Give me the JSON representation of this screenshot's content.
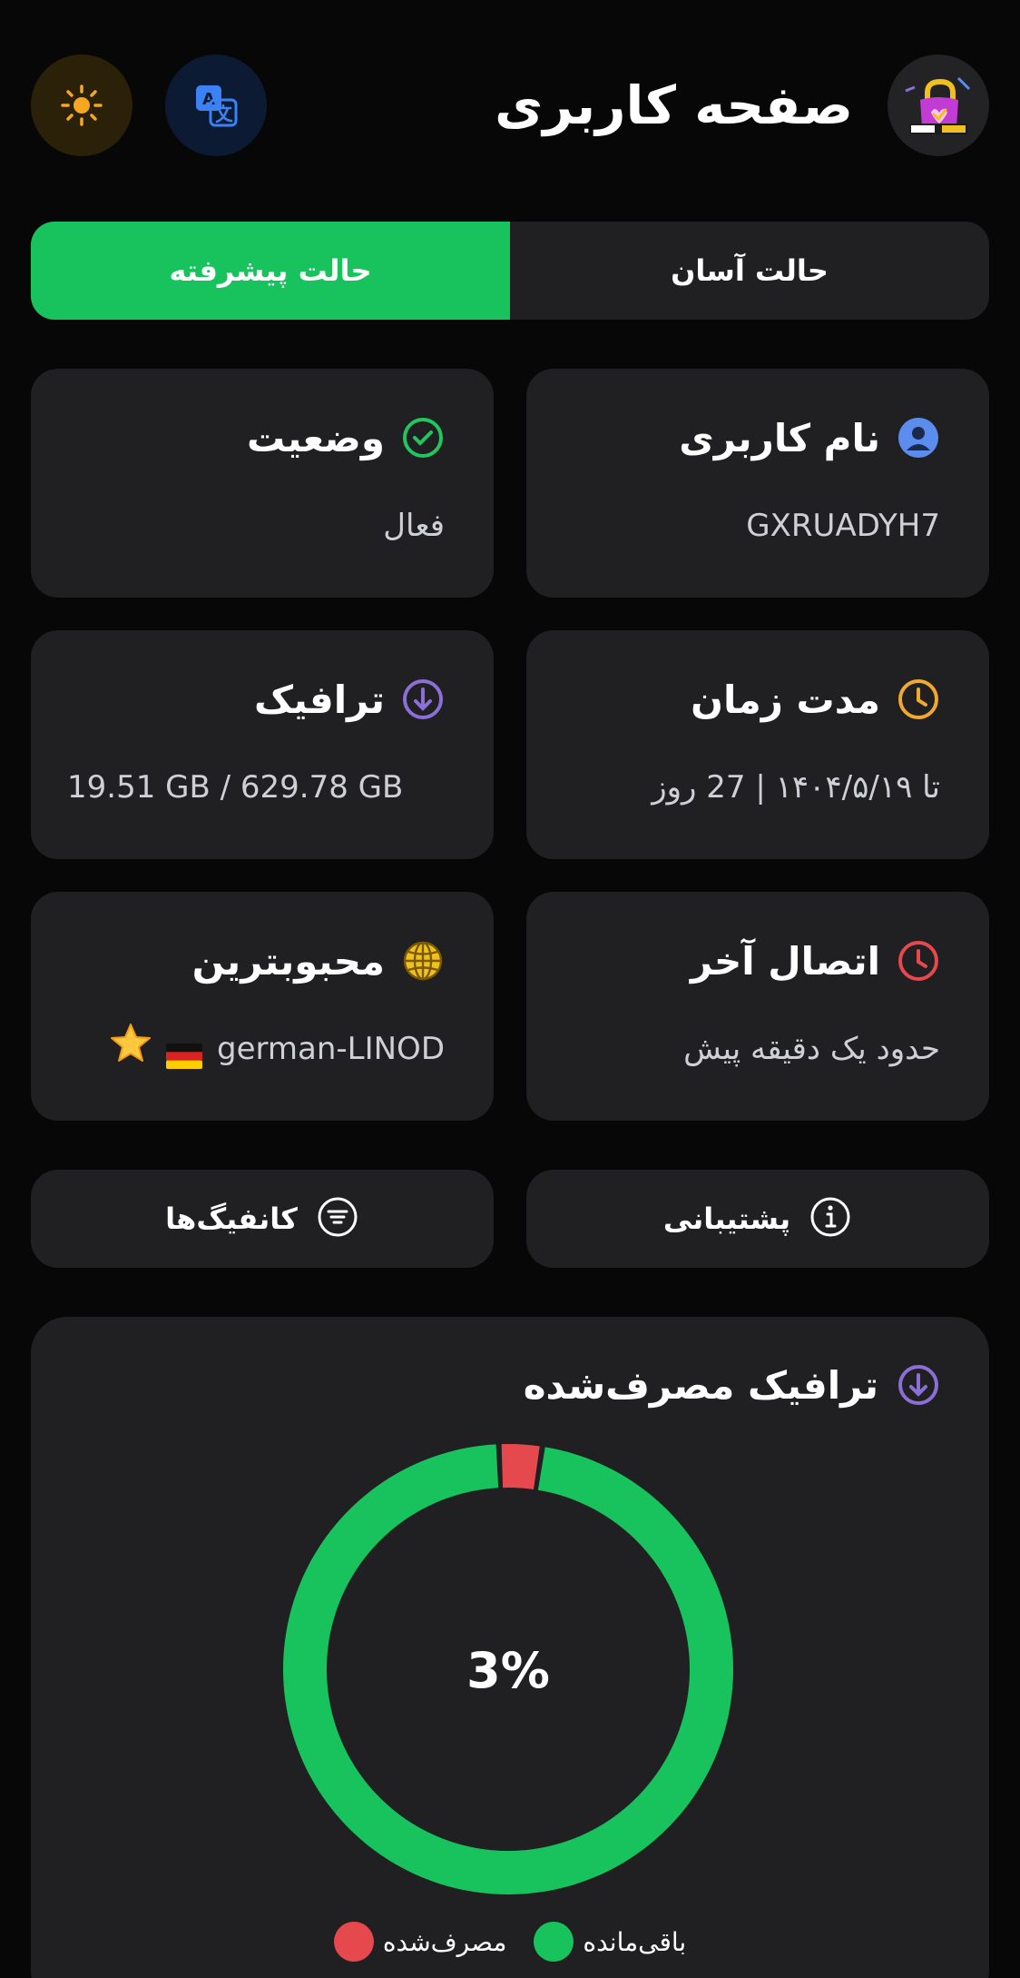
{
  "header": {
    "title": "صفحه کاربری",
    "theme_icon": "sun-icon",
    "lang_icon": "translate-icon",
    "avatar_alt": "SAFE VPN"
  },
  "mode": {
    "easy_label": "حالت آسان",
    "advanced_label": "حالت پیشرفته",
    "active": "advanced"
  },
  "cards": {
    "username": {
      "title": "نام کاربری",
      "value": "GXRUADYH7",
      "icon": "user-icon",
      "color": "#5b8def"
    },
    "status": {
      "title": "وضعیت",
      "value": "فعال",
      "icon": "check-circle-icon",
      "color": "#22c55e"
    },
    "duration": {
      "title": "مدت زمان",
      "value": "تا ۱۴۰۴/۵/۱۹ | 27 روز",
      "icon": "clock-icon",
      "color": "#f0a830"
    },
    "traffic": {
      "title": "ترافیک",
      "value": "19.51 GB / 629.78 GB",
      "icon": "download-icon",
      "color": "#8b6fd6"
    },
    "last_connection": {
      "title": "اتصال آخر",
      "value": "حدود یک دقیقه پیش",
      "icon": "clock-icon",
      "color": "#e5484d"
    },
    "favorite": {
      "title": "محبوبترین",
      "value": "german-LINOD",
      "icon": "globe-icon",
      "color": "#f0c020"
    }
  },
  "actions": {
    "support_label": "پشتیبانی",
    "configs_label": "کانفیگ‌ها"
  },
  "chart": {
    "title": "ترافیک مصرف‌شده",
    "center_label": "3%"
  },
  "chart_data": {
    "type": "pie",
    "donut": true,
    "categories": [
      "مصرف‌شده",
      "باقی‌مانده"
    ],
    "values": [
      19.51,
      610.27
    ],
    "colors": [
      "#e5484d",
      "#18c35d"
    ],
    "center_text": "3%",
    "legend": "bottom"
  }
}
